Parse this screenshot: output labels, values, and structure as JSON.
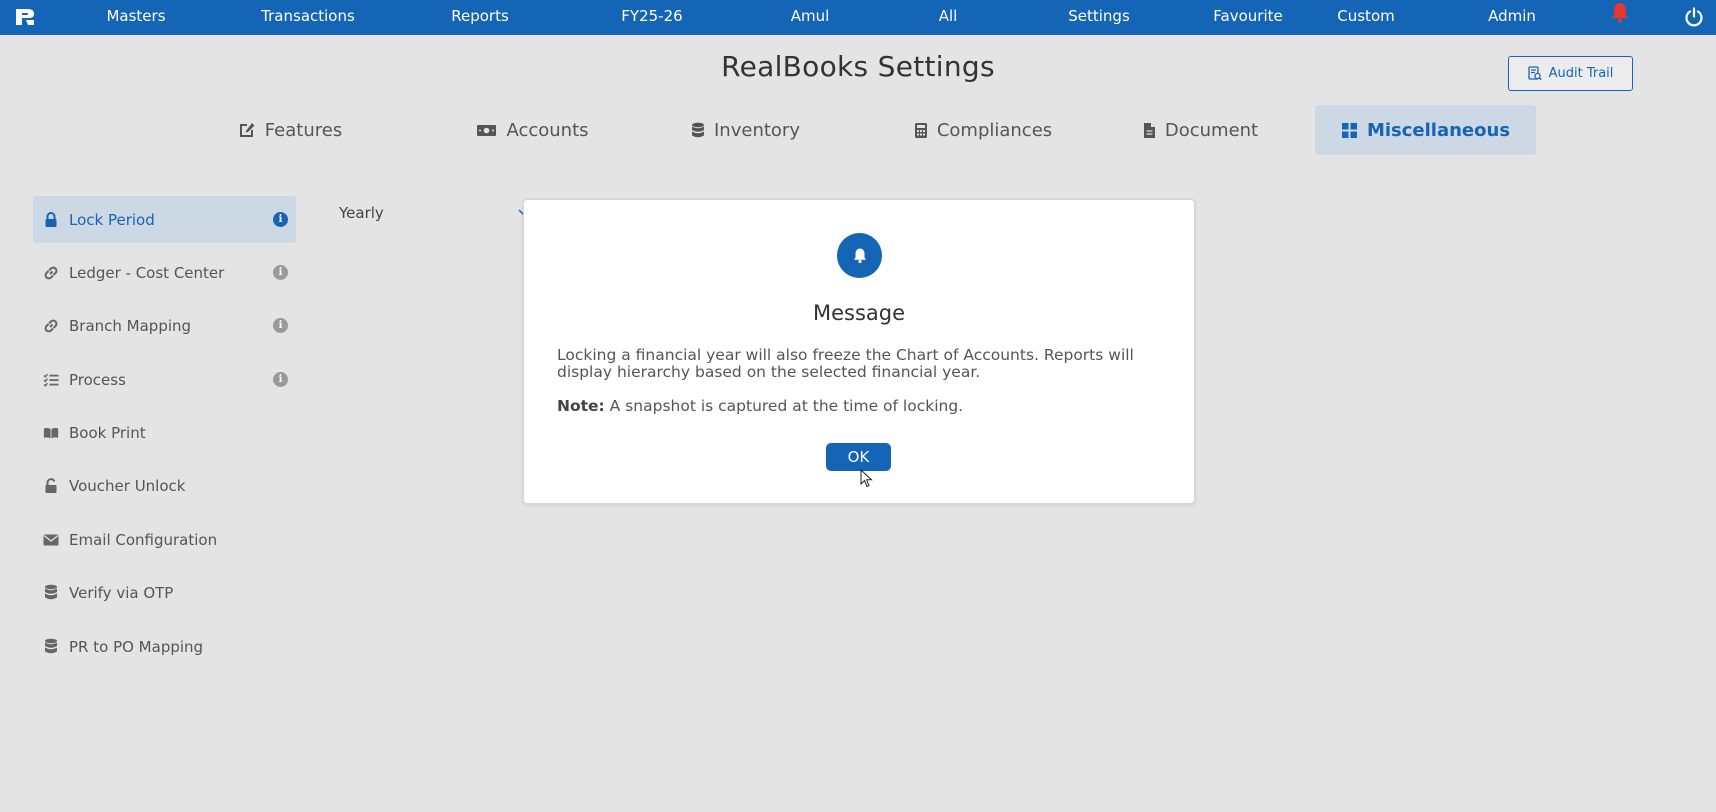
{
  "nav": {
    "items": [
      "Masters",
      "Transactions",
      "Reports",
      "FY25-26",
      "Amul",
      "All",
      "Settings",
      "Favourite",
      "Custom",
      "Admin"
    ],
    "accent": "#1565b6",
    "bell_color": "#e53935"
  },
  "header": {
    "title": "RealBooks Settings",
    "audit_label": "Audit Trail"
  },
  "tabs": [
    {
      "label": "Features",
      "icon": "edit-icon"
    },
    {
      "label": "Accounts",
      "icon": "money-icon"
    },
    {
      "label": "Inventory",
      "icon": "database-icon"
    },
    {
      "label": "Compliances",
      "icon": "calculator-icon"
    },
    {
      "label": "Document",
      "icon": "file-icon"
    },
    {
      "label": "Miscellaneous",
      "icon": "grid-icon",
      "active": true
    }
  ],
  "sidebar": {
    "items": [
      {
        "label": "Lock Period",
        "icon": "lock-icon",
        "active": true,
        "info": true
      },
      {
        "label": "Ledger - Cost Center",
        "icon": "link-icon",
        "info": true
      },
      {
        "label": "Branch Mapping",
        "icon": "link-icon",
        "info": true
      },
      {
        "label": "Process",
        "icon": "list-check-icon",
        "info": true
      },
      {
        "label": "Book Print",
        "icon": "book-icon"
      },
      {
        "label": "Voucher Unlock",
        "icon": "unlock-icon"
      },
      {
        "label": "Email Configuration",
        "icon": "envelope-icon"
      },
      {
        "label": "Verify via OTP",
        "icon": "database-icon"
      },
      {
        "label": "PR to PO Mapping",
        "icon": "database-icon"
      }
    ]
  },
  "content": {
    "period_label": "Yearly"
  },
  "modal": {
    "title": "Message",
    "body": "Locking a financial year will also freeze the Chart of Accounts. Reports will display hierarchy based on the selected financial year.",
    "note_label": "Note:",
    "note_text": " A snapshot is captured at the time of locking.",
    "ok_label": "OK"
  }
}
